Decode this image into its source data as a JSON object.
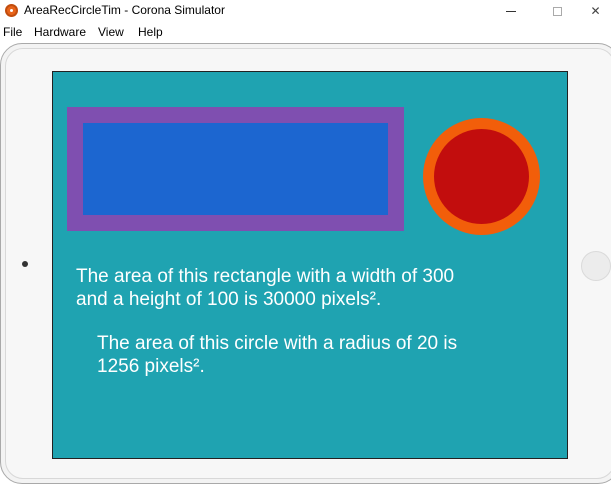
{
  "window": {
    "title": "AreaRecCircleTim - Corona Simulator",
    "close_glyph": "✕"
  },
  "menu": {
    "items": [
      "File",
      "Hardware",
      "View",
      "Help"
    ]
  },
  "app": {
    "rectangle": {
      "width": 300,
      "height": 100,
      "fill_color": "#1c66d0",
      "stroke_color": "#7f4fb0"
    },
    "circle": {
      "radius": 20,
      "fill_color": "#c20d0d",
      "stroke_color": "#f25e0a"
    },
    "background_color": "#1fa3b1",
    "rect_text": "The area of this rectangle with a width of 300 and a height of 100 is 30000 pixels².",
    "circle_text": "The area of this circle with a radius of 20 is 1256 pixels²."
  }
}
